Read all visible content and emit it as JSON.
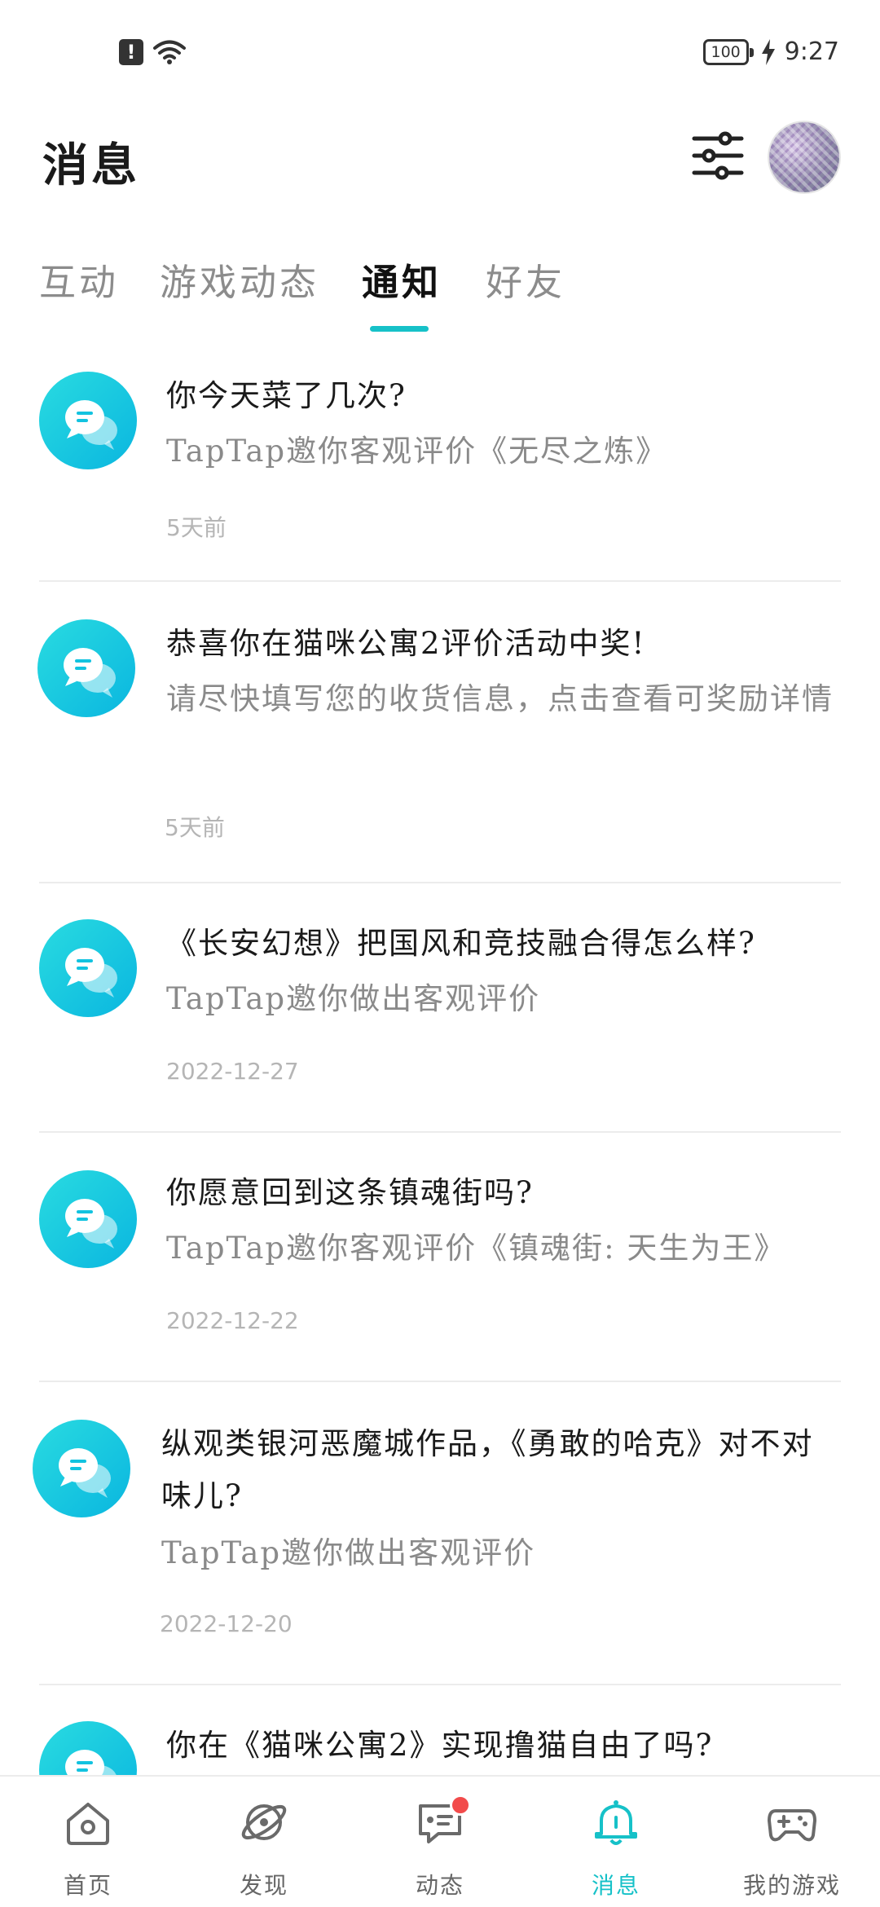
{
  "status_bar": {
    "battery": "100",
    "time": "9:27"
  },
  "header": {
    "title": "消息"
  },
  "tabs": [
    {
      "label": "互动"
    },
    {
      "label": "游戏动态"
    },
    {
      "label": "通知"
    },
    {
      "label": "好友"
    }
  ],
  "active_tab": "通知",
  "notifications": [
    {
      "title": "你今天菜了几次?",
      "desc": "TapTap邀你客观评价《无尽之炼》",
      "time": "5天前"
    },
    {
      "title": "恭喜你在猫咪公寓2评价活动中奖!",
      "desc": "请尽快填写您的收货信息，点击查看可奖励详情",
      "time": "5天前"
    },
    {
      "title": "《长安幻想》把国风和竞技融合得怎么样?",
      "desc": "TapTap邀你做出客观评价",
      "time": "2022-12-27"
    },
    {
      "title": "你愿意回到这条镇魂街吗?",
      "desc": "TapTap邀你客观评价《镇魂街: 天生为王》",
      "time": "2022-12-22"
    },
    {
      "title": "纵观类银河恶魔城作品，《勇敢的哈克》对不对味儿?",
      "desc": "TapTap邀你做出客观评价",
      "time": "2022-12-20"
    },
    {
      "title": "你在《猫咪公寓2》实现撸猫自由了吗?",
      "desc": "",
      "time": ""
    }
  ],
  "bottom_nav": [
    {
      "label": "首页",
      "icon": "home-icon"
    },
    {
      "label": "发现",
      "icon": "discover-icon"
    },
    {
      "label": "动态",
      "icon": "feed-icon"
    },
    {
      "label": "消息",
      "icon": "bell-icon"
    },
    {
      "label": "我的游戏",
      "icon": "gamepad-icon"
    }
  ],
  "colors": {
    "accent": "#16c1c8",
    "icon_gradient_start": "#29dbe1",
    "icon_gradient_end": "#0ab6df",
    "badge": "#f24b4b"
  }
}
